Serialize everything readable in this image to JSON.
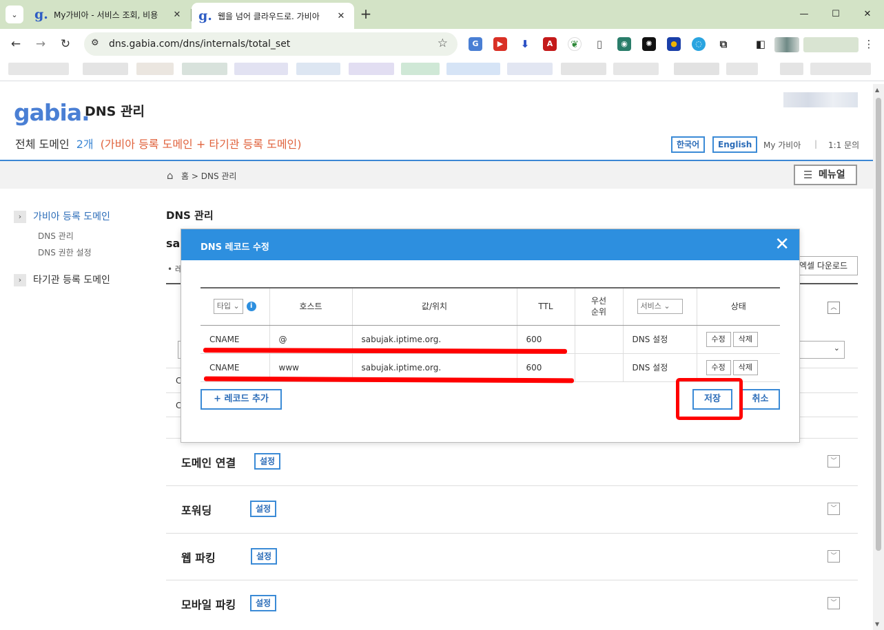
{
  "browser": {
    "tabs": [
      {
        "title": "My가비아 - 서비스 조회, 비용",
        "active": false
      },
      {
        "title": "웹을 넘어 클라우드로. 가비아",
        "active": true
      }
    ],
    "favicon_glyph": "g.",
    "url": "dns.gabia.com/dns/internals/total_set"
  },
  "header": {
    "logo_text": "gabia.",
    "title": "DNS 관리",
    "summary_label": "전체 도메인",
    "summary_count": "2개",
    "summary_desc": "(가비아 등록 도메인 + 타기관 등록 도메인)",
    "lang_ko": "한국어",
    "lang_en": "English",
    "my_gabia": "My 가비아",
    "separator": "|",
    "inquiry": "1:1 문의"
  },
  "breadcrumb": {
    "text": "홈 > DNS 관리",
    "manual_label": "메뉴얼"
  },
  "sidebar": {
    "items": [
      {
        "label": "가비아 등록 도메인",
        "active": true
      },
      {
        "label": "타기관 등록 도메인",
        "active": false
      }
    ],
    "subitems": [
      "DNS 관리",
      "DNS 권한 설정"
    ]
  },
  "main": {
    "title": "DNS 관리",
    "domain_fragment": "sa",
    "bullet_fragment": "• 레",
    "excel_label": "엑셀 다운로드",
    "row_fragment": "C",
    "sections": [
      {
        "name": "도메인 연결",
        "button": "설정"
      },
      {
        "name": "포워딩",
        "button": "설정"
      },
      {
        "name": "웹 파킹",
        "button": "설정"
      },
      {
        "name": "모바일 파킹",
        "button": "설정"
      }
    ]
  },
  "modal": {
    "title": "DNS 레코드 수정",
    "columns": {
      "type": "타입",
      "host": "호스트",
      "value": "값/위치",
      "ttl": "TTL",
      "priority_line1": "우선",
      "priority_line2": "순위",
      "service": "서비스",
      "status": "상태"
    },
    "records": [
      {
        "type": "CNAME",
        "host": "@",
        "value": "sabujak.iptime.org.",
        "ttl": "600",
        "priority": "",
        "service": "DNS 설정",
        "edit": "수정",
        "delete": "삭제"
      },
      {
        "type": "CNAME",
        "host": "www",
        "value": "sabujak.iptime.org.",
        "ttl": "600",
        "priority": "",
        "service": "DNS 설정",
        "edit": "수정",
        "delete": "삭제"
      }
    ],
    "add_label": "+ 레코드 추가",
    "save_label": "저장",
    "cancel_label": "취소"
  },
  "colors": {
    "accent": "#2d8fdf",
    "brand": "#4a7fd4",
    "highlight": "#ff0000",
    "tabbar": "#d3e3c6"
  }
}
